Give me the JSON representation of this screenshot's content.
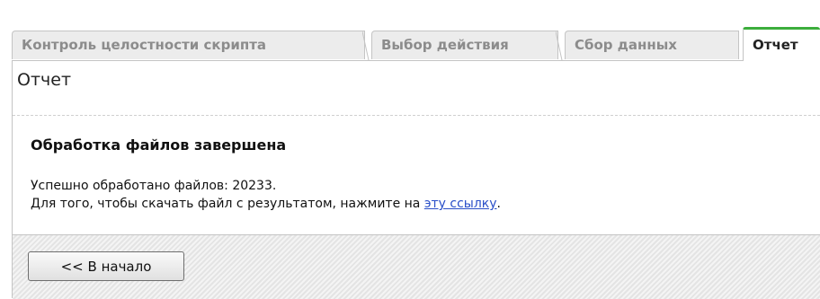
{
  "tabs": [
    {
      "label": "Контроль целостности скрипта",
      "active": false
    },
    {
      "label": "Выбор действия",
      "active": false
    },
    {
      "label": "Сбор данных",
      "active": false
    },
    {
      "label": "Отчет",
      "active": true
    }
  ],
  "panel": {
    "title": "Отчет",
    "heading": "Обработка файлов завершена",
    "processed_text": "Успешно обработано файлов: 20233.",
    "download_text": "Для того, чтобы скачать файл с результатом, нажмите на ",
    "download_link": "эту ссылку",
    "download_suffix": "."
  },
  "footer": {
    "back_button_label": "<< В начало"
  },
  "colors": {
    "active_tab_accent": "#3cae3c",
    "link": "#2a4fc8"
  }
}
